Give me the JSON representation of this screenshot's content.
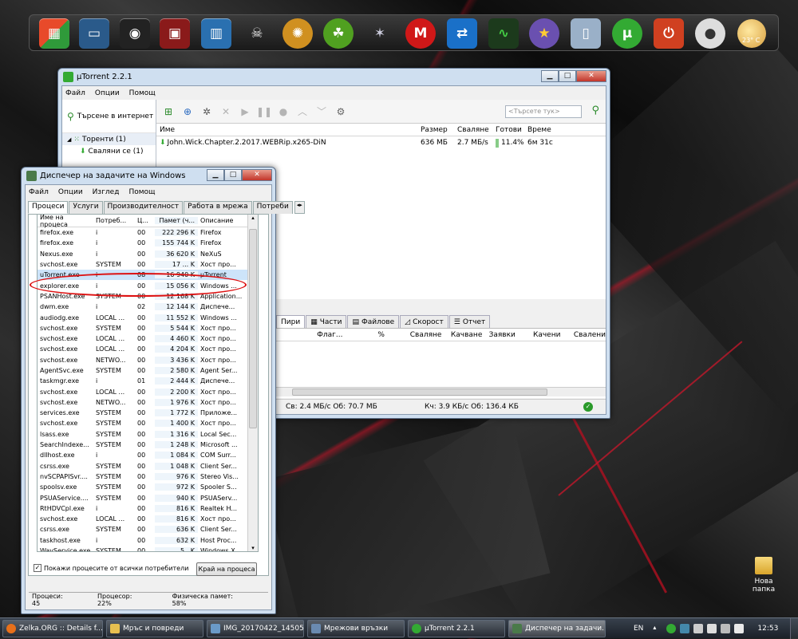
{
  "dock": {
    "icons": [
      "windows-flag-icon",
      "remote-desktop-icon",
      "media-center-icon",
      "film-icon",
      "desktop-icon",
      "skull-icon",
      "malware-icon",
      "green-plant-icon",
      "satellite-icon",
      "mega-icon",
      "teamviewer-icon",
      "monitor-graph-icon",
      "star-icon",
      "trash-icon",
      "utorrent-icon",
      "power-icon",
      "webcam-icon"
    ],
    "weather": "23° C"
  },
  "utorrent": {
    "title": "µTorrent 2.2.1",
    "menu": [
      "Файл",
      "Опции",
      "Помощ"
    ],
    "side_search": "Търсене в интернет",
    "tree": [
      "Торенти (1)",
      "Сваляни се (1)"
    ],
    "search_placeholder": "<Търсете тук>",
    "columns": [
      "Име",
      "Размер",
      "Сваляне",
      "Готови",
      "Време"
    ],
    "torrent": {
      "name": "John.Wick.Chapter.2.2017.WEBRip.x265-DiN",
      "size": "636 МБ",
      "speed": "2.7 МБ/s",
      "done": "11.4%",
      "eta": "6м 31с",
      "progress": 0.114
    },
    "tabs": [
      "Пири",
      "Части",
      "Файлове",
      "Скорост",
      "Отчет"
    ],
    "peer_columns": [
      "Флаг...",
      "%",
      "Сваляне",
      "Качване",
      "Заявки",
      "Качени",
      "Свалени"
    ],
    "status_dl": "Св: 2.4 МБ/с Об: 70.7 МБ",
    "status_ul": "Кч: 3.9 КБ/с Об: 136.4 КБ"
  },
  "taskmgr": {
    "title": "Диспечер на задачите на Windows",
    "menu": [
      "Файл",
      "Опции",
      "Изглед",
      "Помощ"
    ],
    "tabs": [
      "Процеси",
      "Услуги",
      "Производителност",
      "Работа в мрежа",
      "Потреби"
    ],
    "columns": [
      "Име на процеса",
      "Потреб...",
      "Ц...",
      "Памет (ч...",
      "Описание"
    ],
    "processes": [
      [
        "firefox.exe",
        "i",
        "00",
        "222 296 K",
        "Firefox"
      ],
      [
        "firefox.exe",
        "i",
        "00",
        "155 744 K",
        "Firefox"
      ],
      [
        "Nexus.exe",
        "i",
        "00",
        "36 620 K",
        "NeXuS"
      ],
      [
        "svchost.exe",
        "SYSTEM",
        "00",
        "17 ... K",
        "Хост про..."
      ],
      [
        "uTorrent.exe",
        "i",
        "08",
        "16 940 K",
        "µTorrent"
      ],
      [
        "explorer.exe",
        "i",
        "00",
        "15 056 K",
        "Windows ..."
      ],
      [
        "PSANHost.exe",
        "SYSTEM",
        "00",
        "12 168 K",
        "Application..."
      ],
      [
        "dwm.exe",
        "i",
        "02",
        "12 144 K",
        "Диспече..."
      ],
      [
        "audiodg.exe",
        "LOCAL ...",
        "00",
        "11 552 K",
        "Windows ..."
      ],
      [
        "svchost.exe",
        "SYSTEM",
        "00",
        "5 544 K",
        "Хост про..."
      ],
      [
        "svchost.exe",
        "LOCAL ...",
        "00",
        "4 460 K",
        "Хост про..."
      ],
      [
        "svchost.exe",
        "LOCAL ...",
        "00",
        "4 204 K",
        "Хост про..."
      ],
      [
        "svchost.exe",
        "NETWO...",
        "00",
        "3 436 K",
        "Хост про..."
      ],
      [
        "AgentSvc.exe",
        "SYSTEM",
        "00",
        "2 580 K",
        "Agent Ser..."
      ],
      [
        "taskmgr.exe",
        "i",
        "01",
        "2 444 K",
        "Диспече..."
      ],
      [
        "svchost.exe",
        "LOCAL ...",
        "00",
        "2 200 K",
        "Хост про..."
      ],
      [
        "svchost.exe",
        "NETWO...",
        "00",
        "1 976 K",
        "Хост про..."
      ],
      [
        "services.exe",
        "SYSTEM",
        "00",
        "1 772 K",
        "Приложе..."
      ],
      [
        "svchost.exe",
        "SYSTEM",
        "00",
        "1 400 K",
        "Хост про..."
      ],
      [
        "lsass.exe",
        "SYSTEM",
        "00",
        "1 316 K",
        "Local Sec..."
      ],
      [
        "SearchIndexe...",
        "SYSTEM",
        "00",
        "1 248 K",
        "Microsoft ..."
      ],
      [
        "dllhost.exe",
        "i",
        "00",
        "1 084 K",
        "COM Surr..."
      ],
      [
        "csrss.exe",
        "SYSTEM",
        "00",
        "1 048 K",
        "Client Ser..."
      ],
      [
        "nvSCPAPISvr....",
        "SYSTEM",
        "00",
        "976 K",
        "Stereo Vis..."
      ],
      [
        "spoolsv.exe",
        "SYSTEM",
        "00",
        "972 K",
        "Spooler S..."
      ],
      [
        "PSUAService....",
        "SYSTEM",
        "00",
        "940 K",
        "PSUAServ..."
      ],
      [
        "RtHDVCpl.exe",
        "i",
        "00",
        "816 K",
        "Realtek H..."
      ],
      [
        "svchost.exe",
        "LOCAL ...",
        "00",
        "816 K",
        "Хост про..."
      ],
      [
        "csrss.exe",
        "SYSTEM",
        "00",
        "636 K",
        "Client Ser..."
      ],
      [
        "taskhost.exe",
        "i",
        "00",
        "632 K",
        "Host Proc..."
      ],
      [
        "WavService.exe",
        "SYSTEM",
        "00",
        "5.. K",
        "Windows X..."
      ]
    ],
    "selected_index": 4,
    "show_all_label": "Покажи процесите от всички потребители",
    "end_process": "Край на процеса",
    "status_processes": "Процеси: 45",
    "status_cpu": "Процесор: 22%",
    "status_mem": "Физическа памет: 58%"
  },
  "desktop": {
    "folder_label": "Нова папка"
  },
  "taskbar": {
    "buttons": [
      "Zelka.ORG :: Details f...",
      "Мръс и повреди",
      "IMG_20170422_14505...",
      "Мрежови връзки",
      "µTorrent 2.2.1",
      "Диспечер на задачи..."
    ],
    "lang": "EN",
    "clock": "12:53"
  }
}
